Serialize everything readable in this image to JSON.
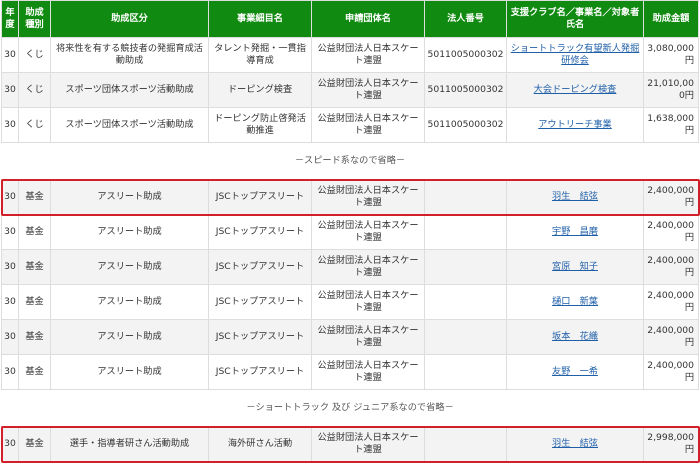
{
  "headers": [
    "年度",
    "助成種別",
    "助成区分",
    "事業細目名",
    "申請団体名",
    "法人番号",
    "支援クラブ名／事業名／対象者氏名",
    "助成金額"
  ],
  "blocks": [
    {
      "kind": "rows",
      "rows": [
        {
          "year": "30",
          "type": "くじ",
          "category": "将来性を有する競技者の発掘育成活動助成",
          "item": "タレント発掘・一貫指導育成",
          "applicant": "公益財団法人日本スケート連盟",
          "corp": "5011005000302",
          "support": "ショートトラック有望新人発掘研修会",
          "amount": "3,080,000円"
        },
        {
          "year": "30",
          "type": "くじ",
          "category": "スポーツ団体スポーツ活動助成",
          "item": "ドーピング検査",
          "applicant": "公益財団法人日本スケート連盟",
          "corp": "5011005000302",
          "support": "大会ドーピング検査",
          "amount": "21,010,000円"
        },
        {
          "year": "30",
          "type": "くじ",
          "category": "スポーツ団体スポーツ活動助成",
          "item": "ドーピング防止啓発活動推進",
          "applicant": "公益財団法人日本スケート連盟",
          "corp": "5011005000302",
          "support": "アウトリーチ事業",
          "amount": "1,638,000円"
        }
      ]
    },
    {
      "kind": "note",
      "text": "－スピード系なので省略－"
    },
    {
      "kind": "rows",
      "rows": [
        {
          "year": "30",
          "type": "基金",
          "category": "アスリート助成",
          "item": "JSCトップアスリート",
          "applicant": "公益財団法人日本スケート連盟",
          "corp": "",
          "support": "羽生　結弦",
          "amount": "2,400,000円",
          "highlight": true
        },
        {
          "year": "30",
          "type": "基金",
          "category": "アスリート助成",
          "item": "JSCトップアスリート",
          "applicant": "公益財団法人日本スケート連盟",
          "corp": "",
          "support": "宇野　昌磨",
          "amount": "2,400,000円"
        },
        {
          "year": "30",
          "type": "基金",
          "category": "アスリート助成",
          "item": "JSCトップアスリート",
          "applicant": "公益財団法人日本スケート連盟",
          "corp": "",
          "support": "宮原　知子",
          "amount": "2,400,000円"
        },
        {
          "year": "30",
          "type": "基金",
          "category": "アスリート助成",
          "item": "JSCトップアスリート",
          "applicant": "公益財団法人日本スケート連盟",
          "corp": "",
          "support": "樋口　新葉",
          "amount": "2,400,000円"
        },
        {
          "year": "30",
          "type": "基金",
          "category": "アスリート助成",
          "item": "JSCトップアスリート",
          "applicant": "公益財団法人日本スケート連盟",
          "corp": "",
          "support": "坂本　花織",
          "amount": "2,400,000円"
        },
        {
          "year": "30",
          "type": "基金",
          "category": "アスリート助成",
          "item": "JSCトップアスリート",
          "applicant": "公益財団法人日本スケート連盟",
          "corp": "",
          "support": "友野　一希",
          "amount": "2,400,000円"
        }
      ]
    },
    {
      "kind": "note",
      "text": "－ショートトラック 及び ジュニア系なので省略－"
    },
    {
      "kind": "rows",
      "rows": [
        {
          "year": "30",
          "type": "基金",
          "category": "選手・指導者研さん活動助成",
          "item": "海外研さん活動",
          "applicant": "公益財団法人日本スケート連盟",
          "corp": "",
          "support": "羽生　結弦",
          "amount": "2,998,000円",
          "highlight": true
        }
      ]
    }
  ],
  "colors": {
    "header_bg": "#108a10",
    "highlight": "#d21f2a",
    "link": "#1f5fa8"
  }
}
